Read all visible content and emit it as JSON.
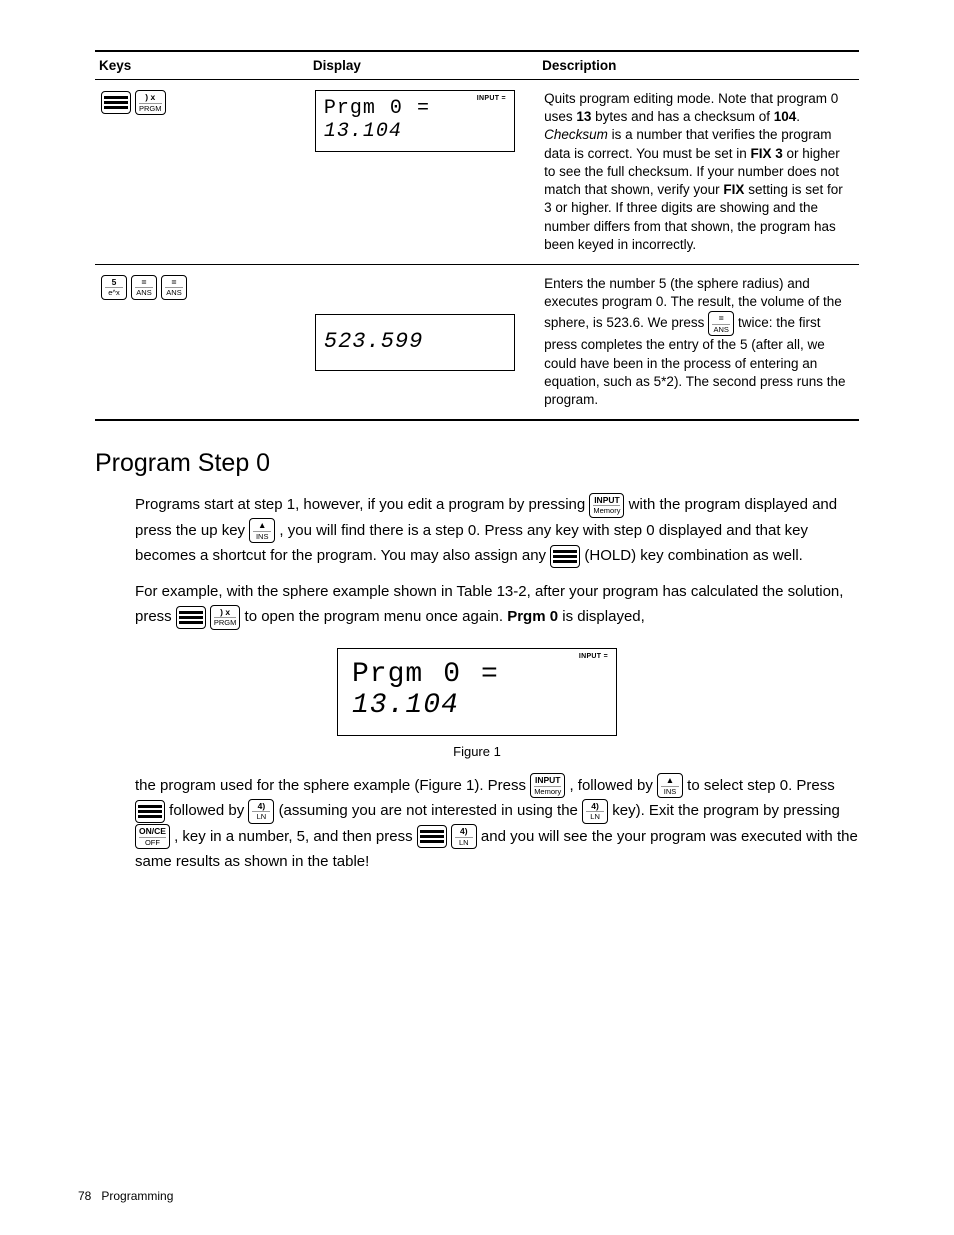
{
  "table": {
    "headers": [
      "Keys",
      "Display",
      "Description"
    ],
    "row1": {
      "lcd_annun": "INPUT =",
      "lcd_line1_a": "Prgm",
      "lcd_line1_b": "0",
      "lcd_line1_c": "=",
      "lcd_line2": "13.104",
      "desc_1": "Quits program editing mode. Note that program 0 uses ",
      "desc_bytes": "13",
      "desc_2": " bytes and has a checksum of ",
      "desc_checksum": "104",
      "desc_3": ". ",
      "desc_checksum_word": "Checksum",
      "desc_4": " is a number that verifies the program data is correct. You must be set in ",
      "desc_fix3": "FIX 3",
      "desc_5": " or higher to see the full checksum. If your number does not match that shown, verify your ",
      "desc_fix": "FIX",
      "desc_6": " setting is set for 3 or higher. If three digits are showing and the number differs from that shown, the program has been keyed in incorrectly."
    },
    "row2": {
      "lcd_value": "523.599",
      "desc_1": "Enters the number 5 (the sphere radius) and executes program 0. The result, the volume of the sphere, is 523.6. We press ",
      "desc_2": " twice: the first press completes the entry of the 5 (after all, we could have been in the process of entering an equation, such as 5*2). The second press runs the program."
    }
  },
  "section_title": "Program Step 0",
  "para1": {
    "t1": "Programs start at step 1, however, if you edit a program by pressing ",
    "t2": " with the program displayed and press the up key ",
    "t3": ", you will find there is a step 0. Press any key with step 0 displayed and that key becomes a shortcut for the program. You may also assign any ",
    "t4": " (HOLD) key combination as well."
  },
  "para2": {
    "t1": "For example, with the sphere example shown in Table 13-2, after your program has calculated the solution, press ",
    "t2": " to open the program menu once again. ",
    "prgm0": "Prgm 0",
    "t3": " is displayed,"
  },
  "big_lcd": {
    "annun": "INPUT =",
    "l1a": "Prgm",
    "l1b": "0",
    "l1c": "=",
    "l2": "13.104"
  },
  "figure_caption": "Figure 1",
  "para3": {
    "t1": "the program used for the sphere example (Figure 1). Press ",
    "t2": ", followed by ",
    "t3": " to select step 0. Press ",
    "t4": "followed by ",
    "t5": "(assuming you are not interested in using the ",
    "t6": " key). Exit the program by pressing ",
    "t7": ", key in a number, 5, and then press ",
    "t8": " and you will see the your program was executed with the same results as shown in the table!"
  },
  "keys": {
    "prgm_top": ") x",
    "prgm_bot": "PRGM",
    "five_top": "5",
    "five_bot": "e^x",
    "ans_top": "=",
    "ans_bot": "ANS",
    "input_top": "INPUT",
    "input_bot": "Memory",
    "up_top": "▲",
    "up_bot": "INS",
    "ln_top": "4)",
    "ln_bot": "LN",
    "once_top": "ON/CE",
    "once_bot": "OFF"
  },
  "footer_page": "78",
  "footer_label": "Programming"
}
